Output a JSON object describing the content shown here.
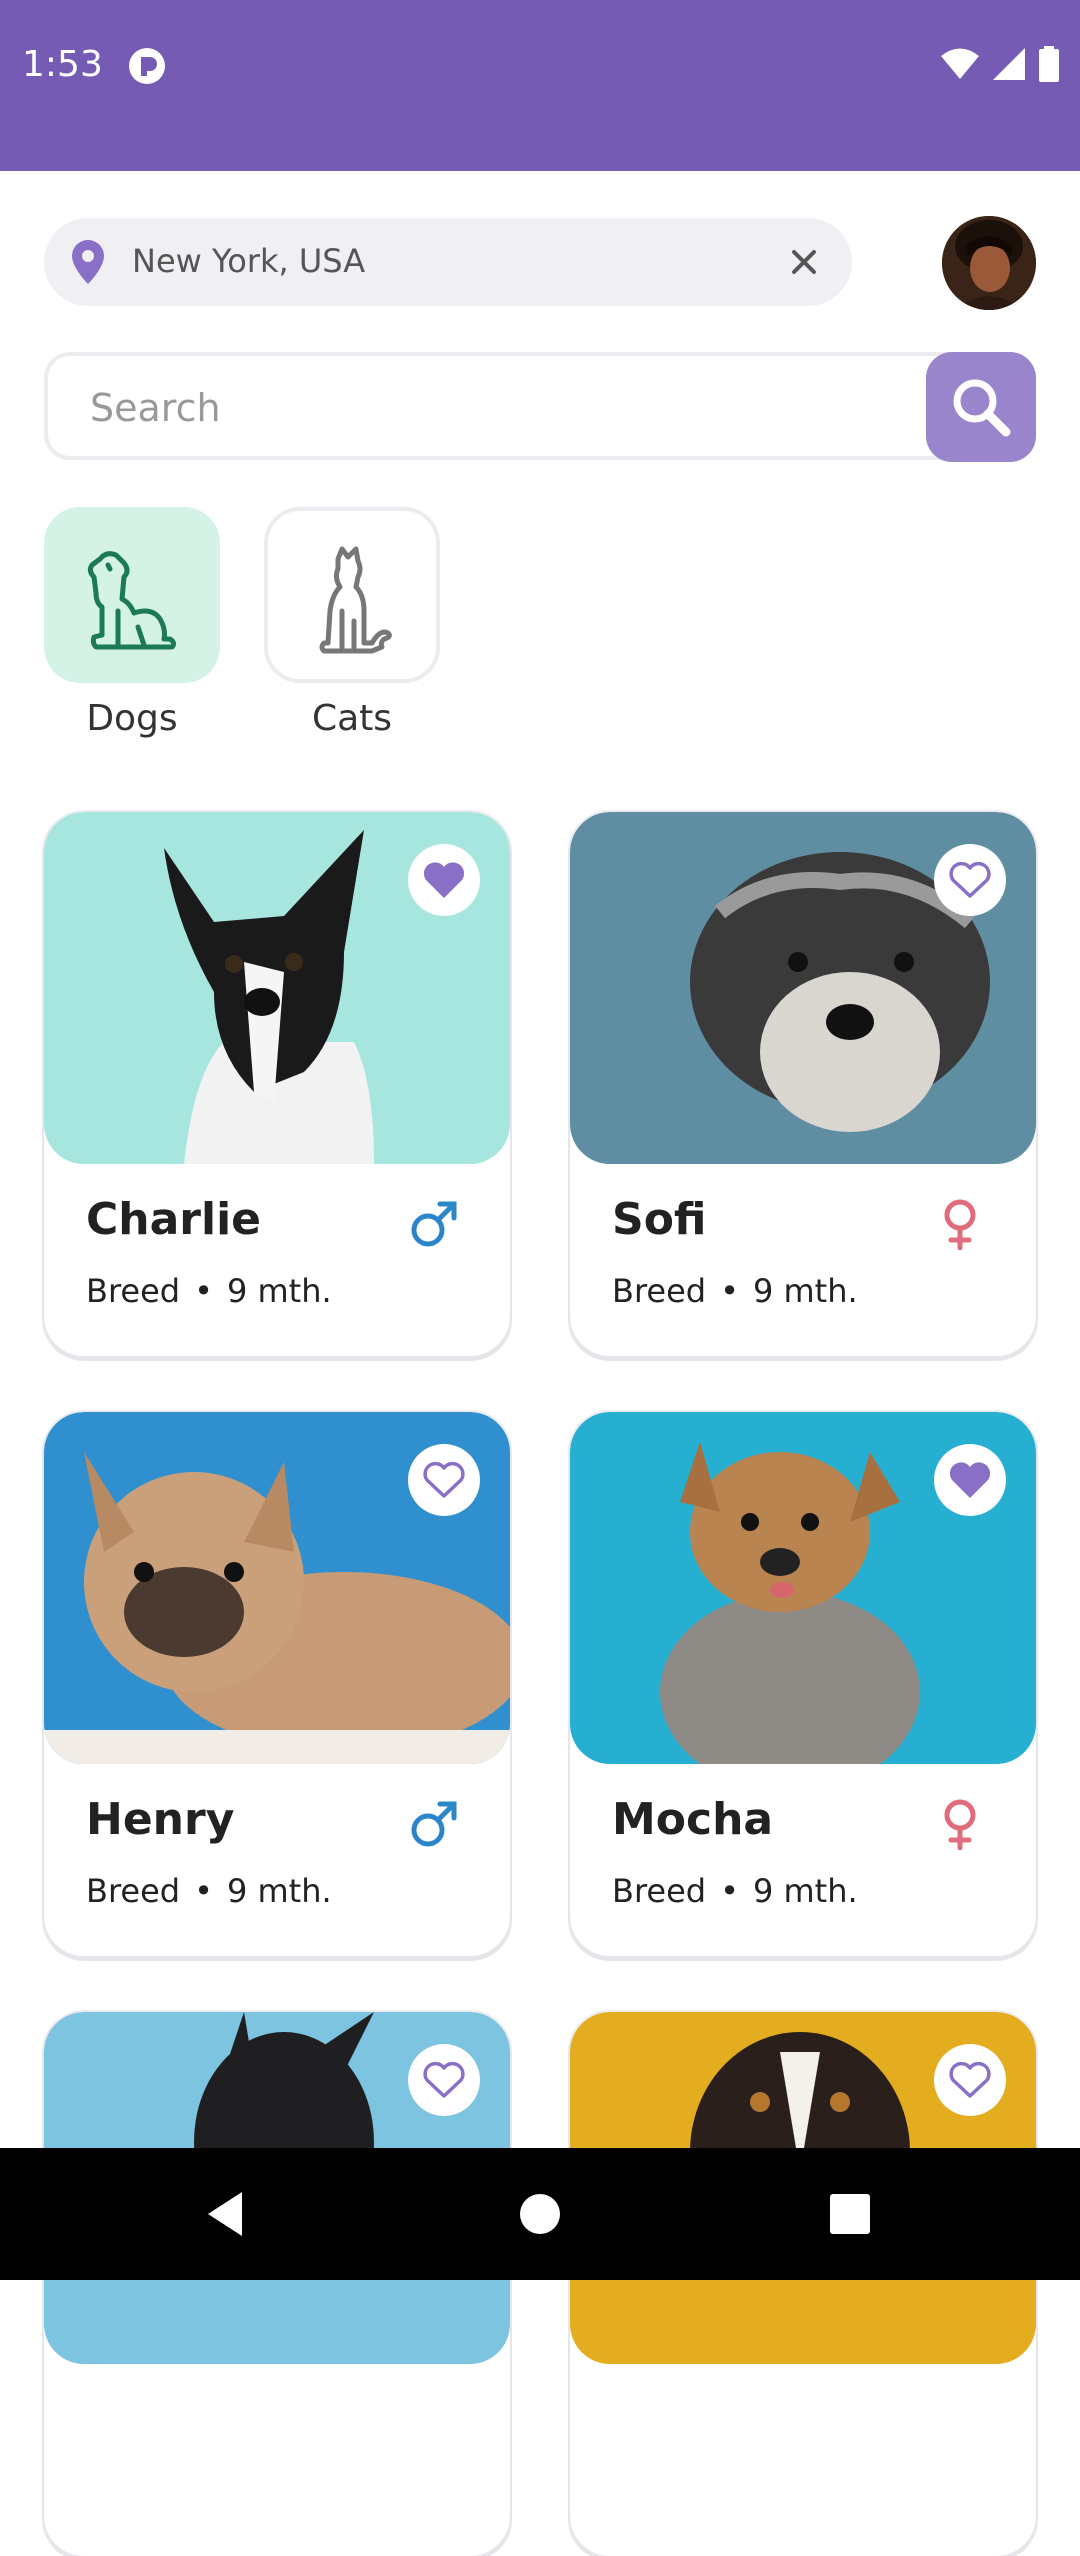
{
  "status": {
    "time": "1:53"
  },
  "location": {
    "value": "New York, USA"
  },
  "search": {
    "placeholder": "Search",
    "value": ""
  },
  "categories": [
    {
      "label": "Dogs",
      "selected": true,
      "icon": "dog-icon"
    },
    {
      "label": "Cats",
      "selected": false,
      "icon": "cat-icon"
    }
  ],
  "pets": [
    {
      "name": "Charlie",
      "breed": "Breed",
      "age": "9 mth.",
      "gender": "male",
      "favorite": true
    },
    {
      "name": "Sofi",
      "breed": "Breed",
      "age": "9 mth.",
      "gender": "female",
      "favorite": false
    },
    {
      "name": "Henry",
      "breed": "Breed",
      "age": "9 mth.",
      "gender": "male",
      "favorite": false
    },
    {
      "name": "Mocha",
      "breed": "Breed",
      "age": "9 mth.",
      "gender": "female",
      "favorite": true
    },
    {
      "favorite": false
    },
    {
      "favorite": false
    }
  ],
  "colors": {
    "accent": "#755bb4",
    "search_button": "#9985cc",
    "male": "#2a86c9",
    "female": "#e06b7b",
    "dogs_tile": "#d4f3e6"
  }
}
